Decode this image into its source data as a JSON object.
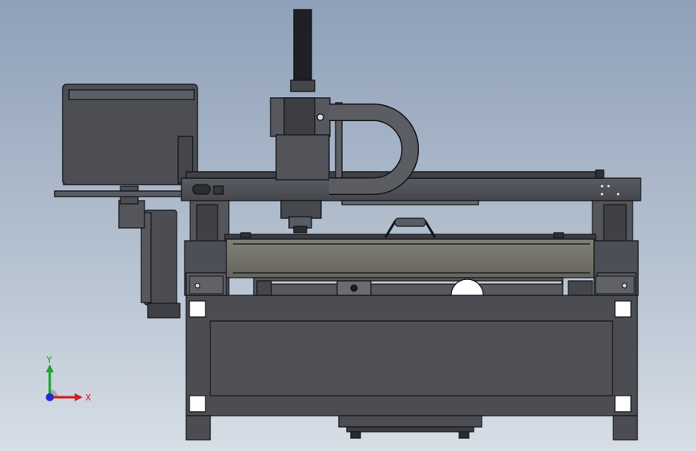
{
  "viewport": {
    "background_top": "#8fa0b8",
    "background_bottom": "#d7dee6"
  },
  "model": {
    "body_color": "#4d4f56",
    "edge_color": "#15161a",
    "light_panel_color": "#6c6e75",
    "bed_color": "#74736a"
  },
  "triad": {
    "x_label": "X",
    "y_label": "Y",
    "x_color": "#d11f1f",
    "y_color": "#1aa32e",
    "z_color": "#1f2fd1"
  }
}
